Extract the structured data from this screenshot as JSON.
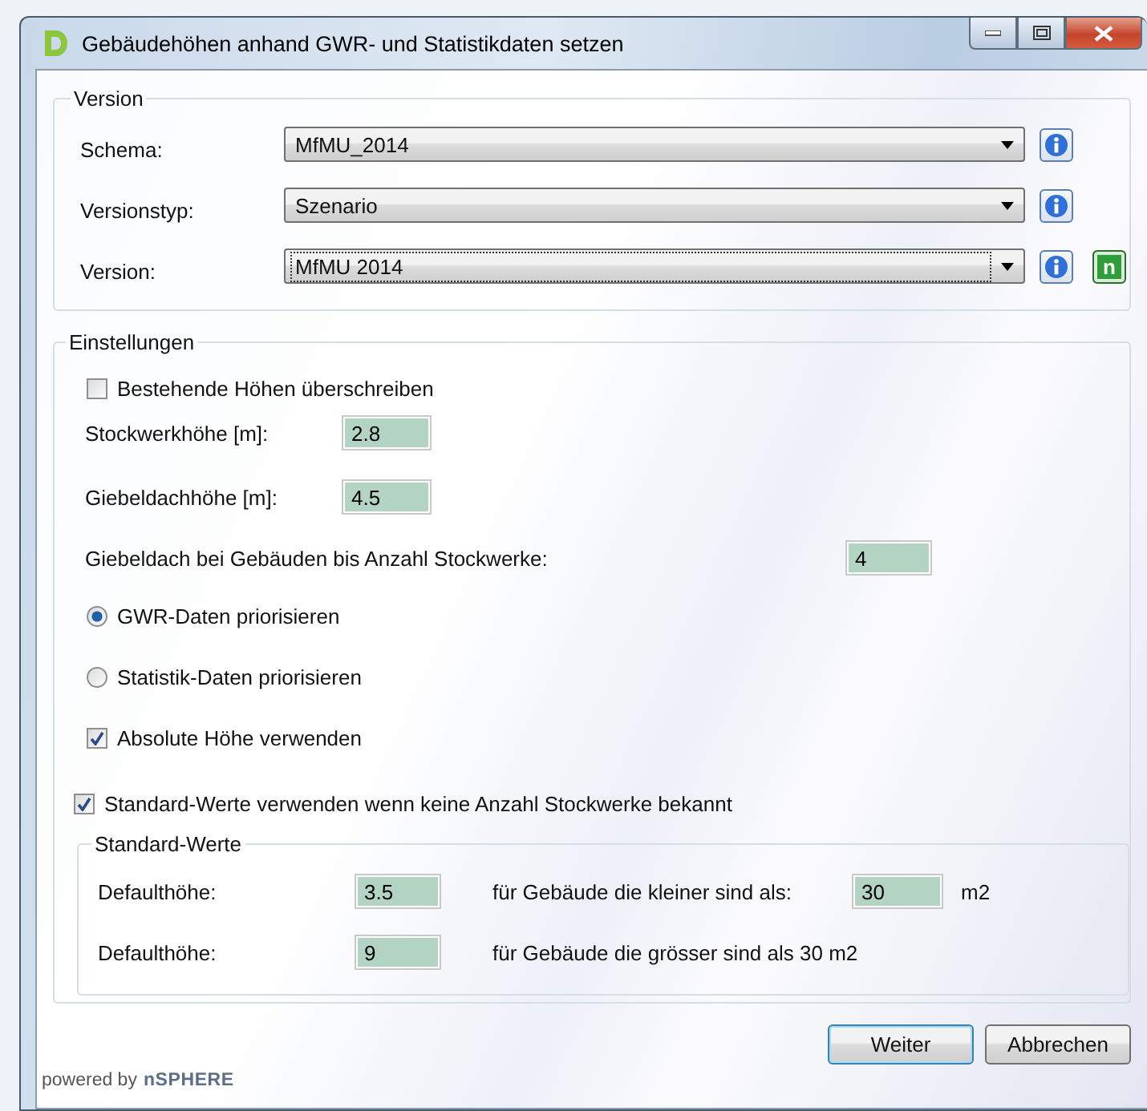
{
  "window": {
    "title": "Gebäudehöhen anhand GWR- und Statistikdaten setzen"
  },
  "version_group": {
    "title": "Version",
    "rows": [
      {
        "label": "Schema:",
        "value": "MfMU_2014",
        "focused": false
      },
      {
        "label": "Versionstyp:",
        "value": "Szenario",
        "focused": false
      },
      {
        "label": "Version:",
        "value": "MfMU 2014",
        "focused": true,
        "new_button": "n"
      }
    ]
  },
  "settings": {
    "title": "Einstellungen",
    "overwrite": {
      "label": "Bestehende Höhen überschreiben",
      "checked": false
    },
    "floor_height": {
      "label": "Stockwerkhöhe [m]:",
      "value": "2.8"
    },
    "gable_height": {
      "label": "Giebeldachhöhe [m]:",
      "value": "4.5"
    },
    "gable_max_floors": {
      "label": "Giebeldach bei Gebäuden bis Anzahl Stockwerke:",
      "value": "4"
    },
    "priority": [
      {
        "label": "GWR-Daten priorisieren",
        "selected": true
      },
      {
        "label": "Statistik-Daten priorisieren",
        "selected": false
      }
    ],
    "absolute_height": {
      "label": "Absolute Höhe verwenden",
      "checked": true
    },
    "use_defaults": {
      "label": "Standard-Werte verwenden wenn keine Anzahl Stockwerke bekannt",
      "checked": true
    },
    "defaults": {
      "title": "Standard-Werte",
      "rows": [
        {
          "label": "Defaulthöhe:",
          "value": "3.5",
          "condition": "für Gebäude die kleiner sind als:",
          "area": "30",
          "unit": "m2"
        },
        {
          "label": "Defaulthöhe:",
          "value": "9",
          "condition": "für Gebäude die grösser sind als 30 m2"
        }
      ]
    }
  },
  "buttons": [
    {
      "label": "Weiter",
      "default": true
    },
    {
      "label": "Abbrechen",
      "default": false
    }
  ],
  "footer": {
    "powered_by": "powered by",
    "brand": "nSPHERE"
  }
}
